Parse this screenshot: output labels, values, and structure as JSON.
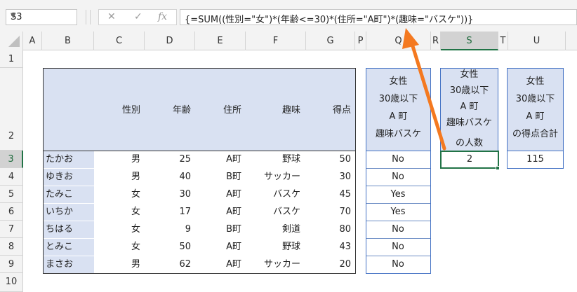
{
  "name_box": "S3",
  "formula_buttons": {
    "cancel": "✕",
    "enter": "✓",
    "fx": "fx"
  },
  "formula": "{=SUM((性別=\"女\")*(年齢<=30)*(住所=\"A町\")*(趣味=\"バスケ\"))}",
  "columns": [
    "A",
    "B",
    "C",
    "D",
    "E",
    "F",
    "G",
    "P",
    "Q",
    "R",
    "S",
    "T",
    "U"
  ],
  "rows": [
    "1",
    "2",
    "3",
    "4",
    "5",
    "6",
    "7",
    "8",
    "9",
    "10"
  ],
  "table": {
    "headers": {
      "gender": "性別",
      "age": "年齢",
      "address": "住所",
      "hobby": "趣味",
      "score": "得点"
    },
    "records": [
      {
        "name": "たかお",
        "gender": "男",
        "age": "25",
        "address": "A町",
        "hobby": "野球",
        "score": "50",
        "flag": "No"
      },
      {
        "name": "ゆきお",
        "gender": "男",
        "age": "40",
        "address": "B町",
        "hobby": "サッカー",
        "score": "30",
        "flag": "No"
      },
      {
        "name": "たみこ",
        "gender": "女",
        "age": "30",
        "address": "A町",
        "hobby": "バスケ",
        "score": "45",
        "flag": "Yes"
      },
      {
        "name": "いちか",
        "gender": "女",
        "age": "17",
        "address": "A町",
        "hobby": "バスケ",
        "score": "70",
        "flag": "Yes"
      },
      {
        "name": "ちはる",
        "gender": "女",
        "age": "9",
        "address": "B町",
        "hobby": "剣道",
        "score": "80",
        "flag": "No"
      },
      {
        "name": "とみこ",
        "gender": "女",
        "age": "50",
        "address": "A町",
        "hobby": "野球",
        "score": "43",
        "flag": "No"
      },
      {
        "name": "まさお",
        "gender": "男",
        "age": "62",
        "address": "A町",
        "hobby": "サッカー",
        "score": "20",
        "flag": "No"
      }
    ]
  },
  "q_header": [
    "女性",
    "30歳以下",
    "A 町",
    "趣味バスケ"
  ],
  "s_header": [
    "女性",
    "30歳以下",
    "A 町",
    "趣味バスケ",
    "の人数"
  ],
  "s_value": "2",
  "u_header": [
    "女性",
    "30歳以下",
    "A 町",
    "の得点合計"
  ],
  "u_value": "115",
  "colors": {
    "accent_arrow": "#f47920",
    "table_fill": "#d9e1f2",
    "selection": "#217346"
  }
}
